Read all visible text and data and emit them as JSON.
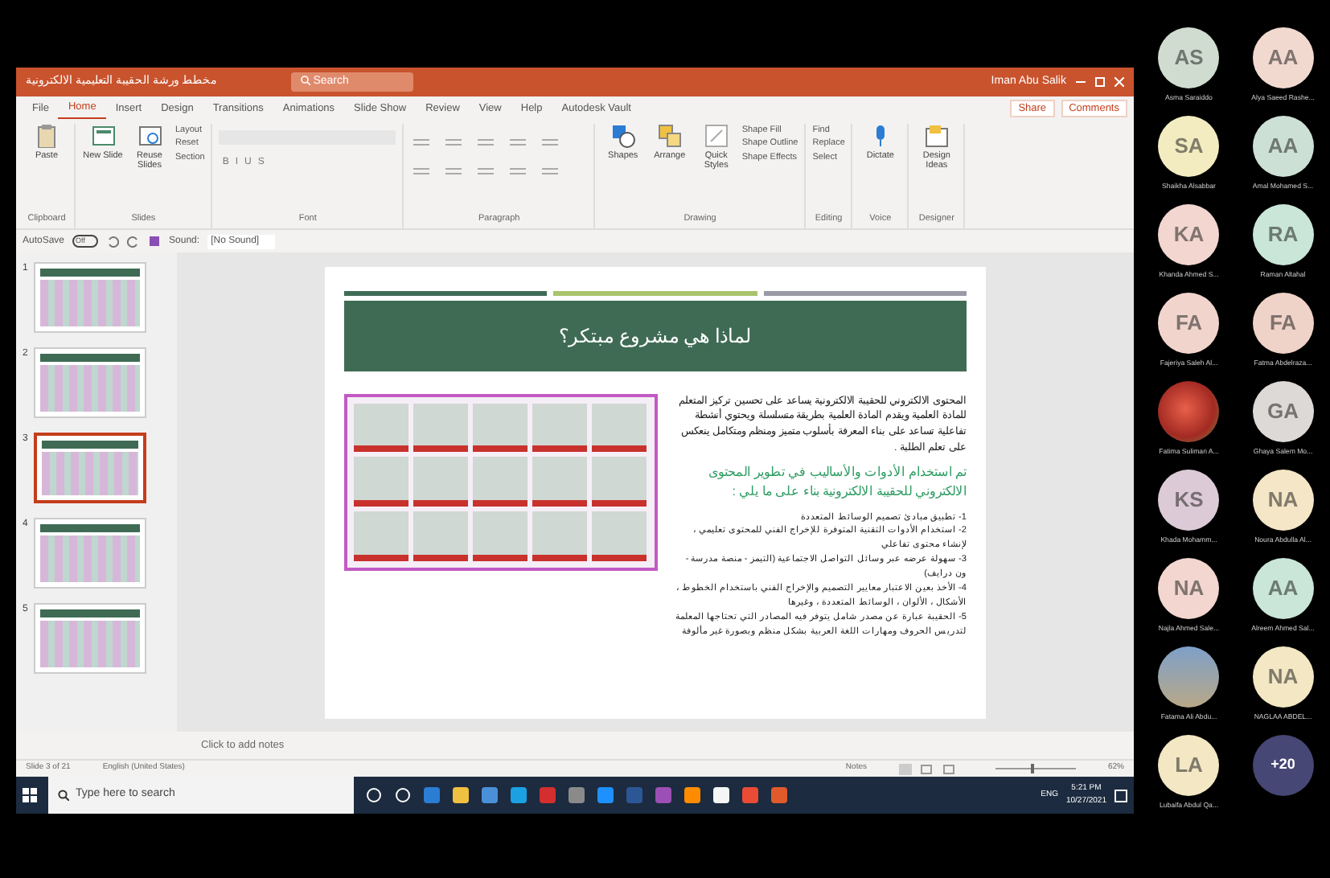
{
  "window": {
    "title": "مخطط ورشة الحقيبة التعليمية الالكترونية",
    "search": "Search",
    "user": "Iman Abu Salik"
  },
  "ribbon": {
    "tabs": [
      {
        "label": "File",
        "selected": false
      },
      {
        "label": "Home",
        "selected": true
      },
      {
        "label": "Insert",
        "selected": false
      },
      {
        "label": "Design",
        "selected": false
      },
      {
        "label": "Transitions",
        "selected": false
      },
      {
        "label": "Animations",
        "selected": false
      },
      {
        "label": "Slide Show",
        "selected": false
      },
      {
        "label": "Review",
        "selected": false
      },
      {
        "label": "View",
        "selected": false
      },
      {
        "label": "Help",
        "selected": false
      },
      {
        "label": "Autodesk Vault",
        "selected": false
      }
    ],
    "share": "Share",
    "comments": "Comments",
    "groups": [
      {
        "label": "Clipboard",
        "buttons": [
          {
            "label": "Paste",
            "kind": "large"
          }
        ]
      },
      {
        "label": "Slides",
        "buttons": [
          {
            "label": "New Slide",
            "kind": "large"
          },
          {
            "label": "Reuse Slides",
            "kind": "large"
          },
          {
            "label": "Layout",
            "kind": "small"
          },
          {
            "label": "Reset",
            "kind": "small"
          },
          {
            "label": "Section",
            "kind": "small"
          }
        ]
      },
      {
        "label": "Font",
        "buttons": [
          {
            "label": "B",
            "kind": "format"
          },
          {
            "label": "I",
            "kind": "format"
          },
          {
            "label": "U",
            "kind": "format"
          },
          {
            "label": "S",
            "kind": "format"
          }
        ]
      },
      {
        "label": "Paragraph"
      },
      {
        "label": "Drawing",
        "buttons": [
          {
            "label": "Shapes",
            "kind": "large"
          },
          {
            "label": "Arrange",
            "kind": "large"
          },
          {
            "label": "Quick Styles",
            "kind": "large"
          },
          {
            "label": "Shape Fill",
            "kind": "small"
          },
          {
            "label": "Shape Outline",
            "kind": "small"
          },
          {
            "label": "Shape Effects",
            "kind": "small"
          }
        ]
      },
      {
        "label": "Editing",
        "buttons": [
          {
            "label": "Find",
            "kind": "small"
          },
          {
            "label": "Replace",
            "kind": "small"
          },
          {
            "label": "Select",
            "kind": "small"
          }
        ]
      },
      {
        "label": "Voice",
        "buttons": [
          {
            "label": "Dictate",
            "kind": "large"
          }
        ]
      },
      {
        "label": "Designer",
        "buttons": [
          {
            "label": "Design Ideas",
            "kind": "large"
          }
        ]
      }
    ]
  },
  "quick_access": {
    "autosave": "AutoSave",
    "autosave_on": false,
    "toggle": "Off",
    "sound_label": "Sound:",
    "sound_value": "[No Sound]"
  },
  "thumbnails": [
    {
      "number": "1",
      "selected": false
    },
    {
      "number": "2",
      "selected": false
    },
    {
      "number": "3",
      "selected": true
    },
    {
      "number": "4",
      "selected": false
    },
    {
      "number": "5",
      "selected": false
    }
  ],
  "slide": {
    "title": "لماذا هي مشروع مبتكر؟",
    "paragraph": "المحتوى الالكتروني للحقيبة الالكترونية يساعد على تحسين تركيز المتعلم للمادة العلمية ويقدم المادة العلمية بطريقة متسلسلة ويحتوي أنشطة تفاعلية تساعد على بناء المعرفة بأسلوب متميز ومنظم ومتكامل ينعكس على تعلم الطلبة .",
    "heading": "تم استخدام الأدوات والأساليب في تطوير المحتوى الالكتروني للحقيبة الالكترونية بناء على ما يلي :",
    "items": [
      "1- تطبيق مبادئ تصميم الوسائط المتعددة",
      "2- استخدام الأدوات التقنية المتوفرة للإخراج الفني للمحتوى تعليمي ، لإنشاء محتوى تفاعلي",
      "3- سهولة عرضه عبر وسائل التواصل الاجتماعية (التيمز - منصة مدرسة - ون درايف)",
      "4- الأخذ بعين الاعتبار معايير التصميم والإخراج الفني باستخدام الخطوط ، الأشكال ، الألوان ، الوسائط المتعددة ، وغيرها",
      "5- الحقيبة عبارة عن مصدر شامل يتوفر فيه المصادر التي تحتاجها المعلمة لتدريس الحروف ومهارات اللغة العربية بشكل منظم وبصورة غير مألوفة"
    ]
  },
  "notes": {
    "placeholder": "Click to add notes"
  },
  "status_bar": {
    "slide": "Slide 3 of 21",
    "language": "English (United States)",
    "notes": "Notes",
    "zoom": "62%"
  },
  "taskbar": {
    "search_placeholder": "Type here to search",
    "language": "ENG",
    "time": "5:21 PM",
    "date": "10/27/2021"
  },
  "participant_rows": [
    {
      "participants": [
        {
          "kind": "initials",
          "initials": "AS",
          "name": "Asma Saraiddo",
          "color": "#cfdccf"
        },
        {
          "kind": "initials",
          "initials": "AA",
          "name": "Alya Saeed Rashe...",
          "color": "#f2d9d0"
        }
      ]
    },
    {
      "participants": [
        {
          "kind": "initials",
          "initials": "SA",
          "name": "Shaikha Alsabbar",
          "color": "#f3ecc0"
        },
        {
          "kind": "initials",
          "initials": "AA",
          "name": "Amal Mohamed S...",
          "color": "#cde0d6"
        }
      ]
    },
    {
      "participants": [
        {
          "kind": "initials",
          "initials": "KA",
          "name": "Khanda Ahmed S...",
          "color": "#f2d6cf"
        },
        {
          "kind": "initials",
          "initials": "RA",
          "name": "Raman Altahal",
          "color": "#c9e6d8"
        }
      ]
    },
    {
      "participants": [
        {
          "kind": "initials",
          "initials": "FA",
          "name": "Fajeriya Saleh Al...",
          "color": "#f1d5cc"
        },
        {
          "kind": "initials",
          "initials": "FA",
          "name": "Fatma Abdelraza...",
          "color": "#f0d3c8"
        }
      ]
    },
    {
      "participants": [
        {
          "kind": "photo",
          "name": "Fatima Suliman A..."
        },
        {
          "kind": "initials",
          "initials": "GA",
          "name": "Ghaya Salem Mo...",
          "color": "#dcd9d6"
        }
      ]
    },
    {
      "participants": [
        {
          "kind": "initials",
          "initials": "KS",
          "name": "Khada Mohamm...",
          "color": "#dccbd6"
        },
        {
          "kind": "initials",
          "initials": "NA",
          "name": "Noura Abdulla Al...",
          "color": "#f4e6c6"
        }
      ]
    },
    {
      "participants": [
        {
          "kind": "initials",
          "initials": "NA",
          "name": "Najla Ahmed Sale...",
          "color": "#f2d6cf"
        },
        {
          "kind": "initials",
          "initials": "AA",
          "name": "Alreem Ahmed Sal...",
          "color": "#c9e6d8"
        }
      ]
    },
    {
      "participants": [
        {
          "kind": "photo",
          "name": "Fatama Ali Abdu..."
        },
        {
          "kind": "initials",
          "initials": "NA",
          "name": "NAGLAA ABDEL...",
          "color": "#f3e7c4"
        }
      ]
    },
    {
      "participants": [
        {
          "kind": "initials",
          "initials": "LA",
          "name": "Lubaifa Abdul Qa...",
          "color": "#f3e7c4"
        },
        {
          "kind": "more",
          "initials": "+20",
          "color": "#464775"
        }
      ]
    }
  ]
}
